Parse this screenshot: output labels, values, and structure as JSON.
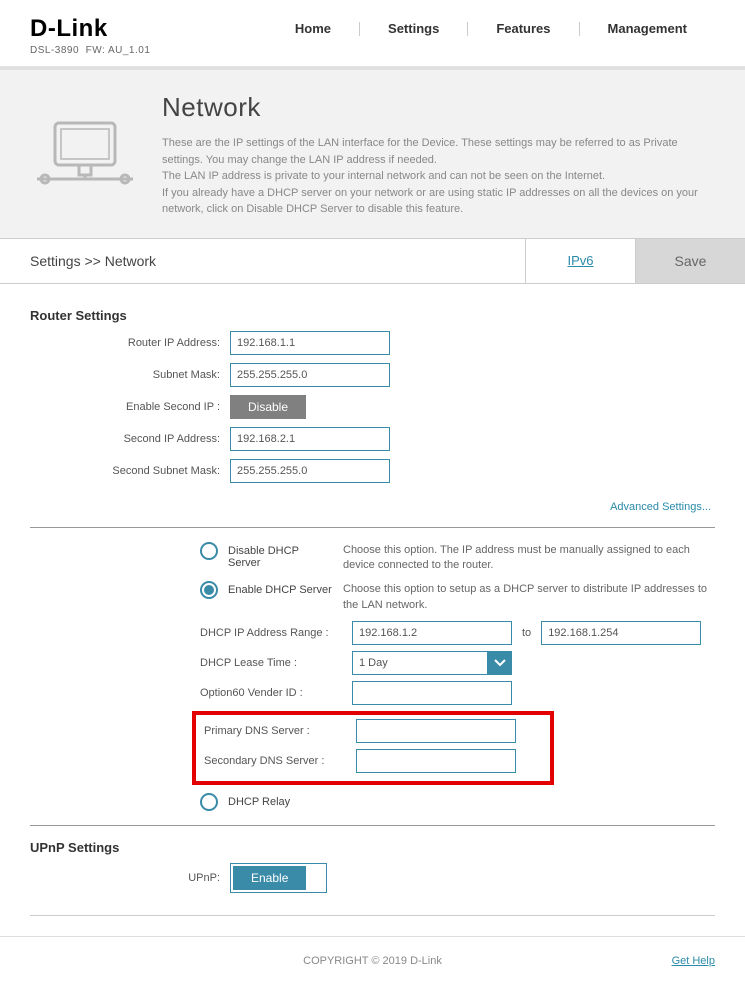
{
  "header": {
    "brand": "D-Link",
    "model": "DSL-3890",
    "fw": "FW: AU_1.01",
    "nav": [
      "Home",
      "Settings",
      "Features",
      "Management"
    ]
  },
  "hero": {
    "title": "Network",
    "desc1": "These are the IP settings of the LAN interface for the Device. These settings may be referred to as Private settings. You may change the LAN IP address if needed.",
    "desc2": "The LAN IP address is private to your internal network and can not be seen on the Internet.",
    "desc3": "If you already have a DHCP server on your network or are using static IP addresses on all the devices on your network, click on Disable DHCP Server to disable this feature."
  },
  "bar": {
    "breadcrumb": "Settings >> Network",
    "tab": "IPv6",
    "save": "Save"
  },
  "router": {
    "section": "Router Settings",
    "ip_label": "Router IP Address:",
    "ip_value": "192.168.1.1",
    "mask_label": "Subnet Mask:",
    "mask_value": "255.255.255.0",
    "second_enable_label": "Enable Second IP :",
    "second_enable_btn": "Disable",
    "second_ip_label": "Second IP Address:",
    "second_ip_value": "192.168.2.1",
    "second_mask_label": "Second Subnet Mask:",
    "second_mask_value": "255.255.255.0",
    "adv_link": "Advanced Settings..."
  },
  "dhcp": {
    "disable_label": "Disable DHCP Server",
    "disable_desc": "Choose this option. The IP address must be manually assigned to each device connected to the router.",
    "enable_label": "Enable DHCP Server",
    "enable_desc": "Choose this option to setup as a DHCP server to distribute IP addresses to the LAN network.",
    "range_label": "DHCP IP Address Range :",
    "range_from": "192.168.1.2",
    "range_to_label": "to",
    "range_to": "192.168.1.254",
    "lease_label": "DHCP Lease Time :",
    "lease_value": "1 Day",
    "option60_label": "Option60 Vender ID :",
    "option60_value": "",
    "primary_dns_label": "Primary DNS Server :",
    "primary_dns_value": "",
    "secondary_dns_label": "Secondary DNS Server :",
    "secondary_dns_value": "",
    "relay_label": "DHCP Relay"
  },
  "upnp": {
    "section": "UPnP Settings",
    "label": "UPnP:",
    "btn": "Enable"
  },
  "footer": {
    "copyright": "COPYRIGHT © 2019 D-Link",
    "help": "Get Help"
  }
}
